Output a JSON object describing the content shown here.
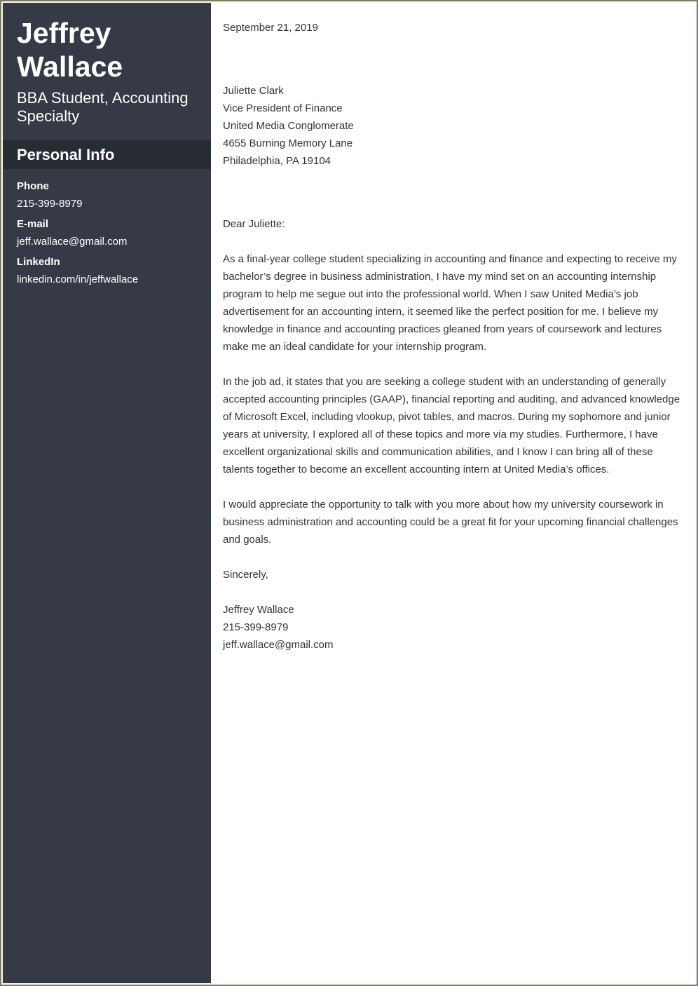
{
  "sidebar": {
    "name_first": "Jeffrey",
    "name_last": "Wallace",
    "subtitle": "BBA Student, Accounting Specialty",
    "section_title": "Personal Info",
    "info": [
      {
        "label": "Phone",
        "value": "215-399-8979"
      },
      {
        "label": "E-mail",
        "value": "jeff.wallace@gmail.com"
      },
      {
        "label": "LinkedIn",
        "value": "linkedin.com/in/jeffwallace"
      }
    ]
  },
  "letter": {
    "date": "September 21, 2019",
    "recipient": [
      "Juliette Clark",
      "Vice President of Finance",
      "United Media Conglomerate",
      "4655 Burning Memory Lane",
      "Philadelphia, PA 19104"
    ],
    "salutation": "Dear Juliette:",
    "paragraphs": [
      "As a final-year college student specializing in accounting and finance and expecting to receive my bachelor’s degree in business administration, I have my mind set on an accounting internship program to help me segue out into the professional world. When I saw United Media’s job advertisement for an accounting intern, it seemed like the perfect position for me. I believe my knowledge in finance and accounting practices gleaned from years of coursework and lectures make me an ideal candidate for your internship program.",
      "In the job ad, it states that you are seeking a college student with an understanding of generally accepted accounting principles (GAAP), financial reporting and auditing, and advanced knowledge of Microsoft Excel, including vlookup, pivot tables, and macros. During my sophomore and junior years at university, I explored all of these topics and more via my studies. Furthermore, I have excellent organizational skills and communication abilities, and I know I can bring all of these talents together to become an excellent accounting intern at United Media’s offices.",
      "I would appreciate the opportunity to talk with you more about how my university coursework in business administration and accounting could be a great fit for your upcoming financial challenges and goals."
    ],
    "closing": "Sincerely,",
    "signature": [
      "Jeffrey Wallace",
      "215-399-8979",
      "jeff.wallace@gmail.com"
    ]
  }
}
